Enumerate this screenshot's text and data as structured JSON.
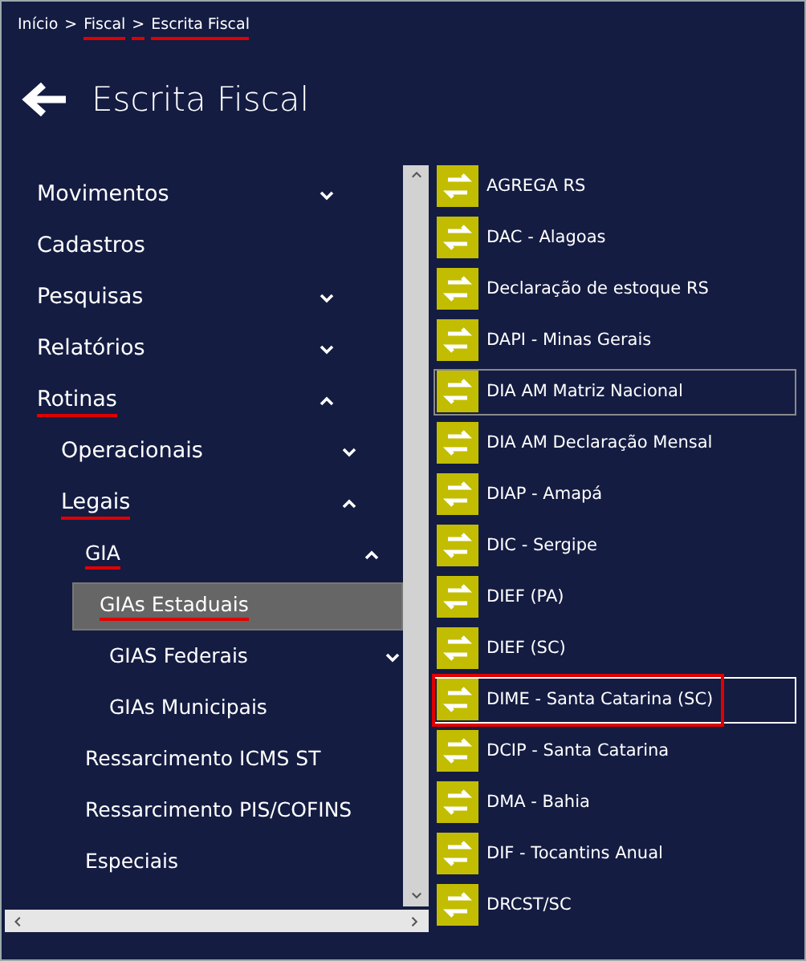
{
  "breadcrumb": [
    {
      "text": "Início",
      "underlined": false
    },
    {
      "text": ">",
      "underlined": false
    },
    {
      "text": "Fiscal",
      "underlined": true
    },
    {
      "text": ">",
      "underlined": true
    },
    {
      "text": "Escrita Fiscal",
      "underlined": true
    }
  ],
  "page_title": "Escrita Fiscal",
  "menu": [
    {
      "label": "Movimentos",
      "expanded": false,
      "selected": false,
      "underlined": false
    },
    {
      "label": "Cadastros",
      "selected": false,
      "underlined": false
    },
    {
      "label": "Pesquisas",
      "expanded": false,
      "selected": false,
      "underlined": false
    },
    {
      "label": "Relatórios",
      "expanded": false,
      "selected": false,
      "underlined": false
    },
    {
      "label": "Rotinas",
      "expanded": true,
      "selected": false,
      "underlined": true,
      "children": [
        {
          "label": "Operacionais",
          "expanded": false,
          "selected": false,
          "underlined": false
        },
        {
          "label": "Legais",
          "expanded": true,
          "selected": false,
          "underlined": true,
          "children": [
            {
              "label": "GIA",
              "expanded": true,
              "selected": false,
              "underlined": true,
              "children": [
                {
                  "label": "GIAs Estaduais",
                  "selected": true,
                  "underlined": true
                },
                {
                  "label": "GIAS Federais",
                  "expanded": false,
                  "selected": false,
                  "underlined": false
                },
                {
                  "label": "GIAs Municipais",
                  "selected": false,
                  "underlined": false
                }
              ]
            },
            {
              "label": "Ressarcimento ICMS ST",
              "selected": false,
              "underlined": false
            },
            {
              "label": "Ressarcimento PIS/COFINS",
              "selected": false,
              "underlined": false
            },
            {
              "label": "Especiais",
              "selected": false,
              "underlined": false
            }
          ]
        }
      ]
    }
  ],
  "routines": [
    {
      "label": "AGREGA RS",
      "focused": false,
      "hovered": false,
      "marked": false
    },
    {
      "label": "DAC - Alagoas",
      "focused": false,
      "hovered": false,
      "marked": false
    },
    {
      "label": "Declaração de estoque RS",
      "focused": false,
      "hovered": false,
      "marked": false
    },
    {
      "label": "DAPI - Minas Gerais",
      "focused": false,
      "hovered": false,
      "marked": false
    },
    {
      "label": "DIA AM Matriz Nacional",
      "focused": false,
      "hovered": true,
      "marked": false
    },
    {
      "label": "DIA AM Declaração Mensal",
      "focused": false,
      "hovered": false,
      "marked": false
    },
    {
      "label": "DIAP - Amapá",
      "focused": false,
      "hovered": false,
      "marked": false
    },
    {
      "label": "DIC - Sergipe",
      "focused": false,
      "hovered": false,
      "marked": false
    },
    {
      "label": "DIEF (PA)",
      "focused": false,
      "hovered": false,
      "marked": false
    },
    {
      "label": "DIEF (SC)",
      "focused": false,
      "hovered": false,
      "marked": false
    },
    {
      "label": "DIME - Santa Catarina (SC)",
      "focused": true,
      "hovered": false,
      "marked": true
    },
    {
      "label": "DCIP - Santa Catarina",
      "focused": false,
      "hovered": false,
      "marked": false
    },
    {
      "label": "DMA - Bahia",
      "focused": false,
      "hovered": false,
      "marked": false
    },
    {
      "label": "DIF - Tocantins Anual",
      "focused": false,
      "hovered": false,
      "marked": false
    },
    {
      "label": "DRCST/SC",
      "focused": false,
      "hovered": false,
      "marked": false
    }
  ]
}
